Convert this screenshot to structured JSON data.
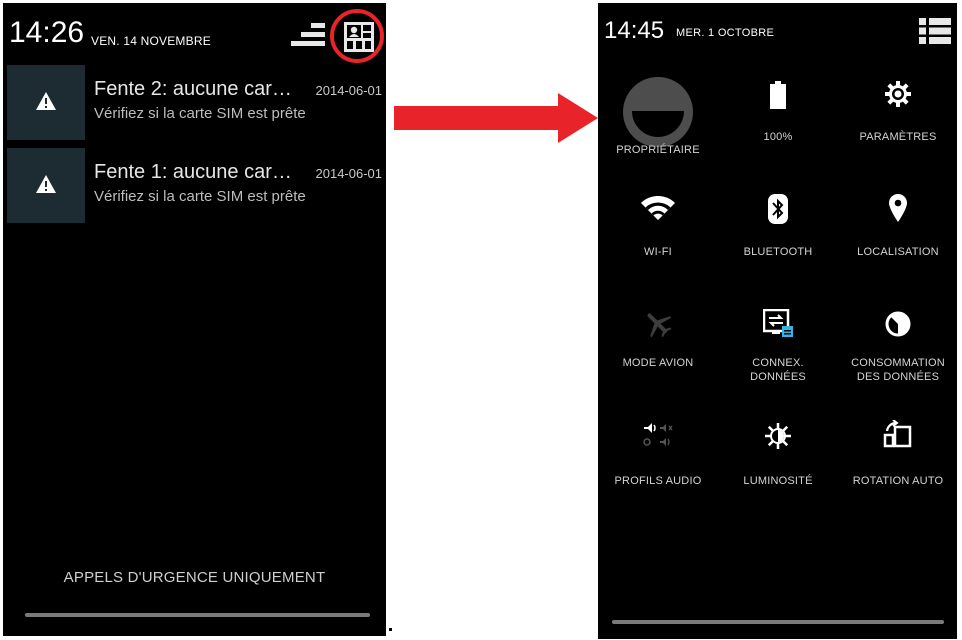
{
  "left_screen": {
    "clock": "14:26",
    "date": "VEN. 14 NOVEMBRE",
    "notifications": [
      {
        "title": "Fente 2: aucune car…",
        "time": "2014-06-01",
        "text": "Vérifiez si la carte SIM est prête"
      },
      {
        "title": "Fente 1: aucune car…",
        "time": "2014-06-01",
        "text": "Vérifiez si la carte SIM est prête"
      }
    ],
    "emergency_text": "APPELS D'URGENCE UNIQUEMENT"
  },
  "right_screen": {
    "clock": "14:45",
    "date": "MER. 1 OCTOBRE",
    "tiles": {
      "owner": "PROPRIÉTAIRE",
      "battery": "100%",
      "settings": "PARAMÈTRES",
      "wifi": "WI-FI",
      "bluetooth": "BLUETOOTH",
      "location": "LOCALISATION",
      "airplane": "MODE AVION",
      "data_line1": "CONNEX.",
      "data_line2": "DONNÉES",
      "usage_line1": "CONSOMMATION",
      "usage_line2": "DES DONNÉES",
      "audio": "PROFILS AUDIO",
      "brightness": "LUMINOSITÉ",
      "rotation": "ROTATION AUTO"
    }
  },
  "colors": {
    "highlight_ring": "#e8232a",
    "arrow": "#e8232a",
    "notif_icon_bg": "#1d2c33",
    "data_badge": "#33b5e5"
  },
  "icons": [
    "warning-icon",
    "clear-notifications-icon",
    "quick-settings-grid-icon",
    "settings-list-icon",
    "battery-icon",
    "gear-icon",
    "wifi-icon",
    "bluetooth-icon",
    "location-pin-icon",
    "airplane-icon",
    "data-connection-icon",
    "data-usage-icon",
    "audio-profiles-icon",
    "brightness-icon",
    "auto-rotate-icon"
  ]
}
